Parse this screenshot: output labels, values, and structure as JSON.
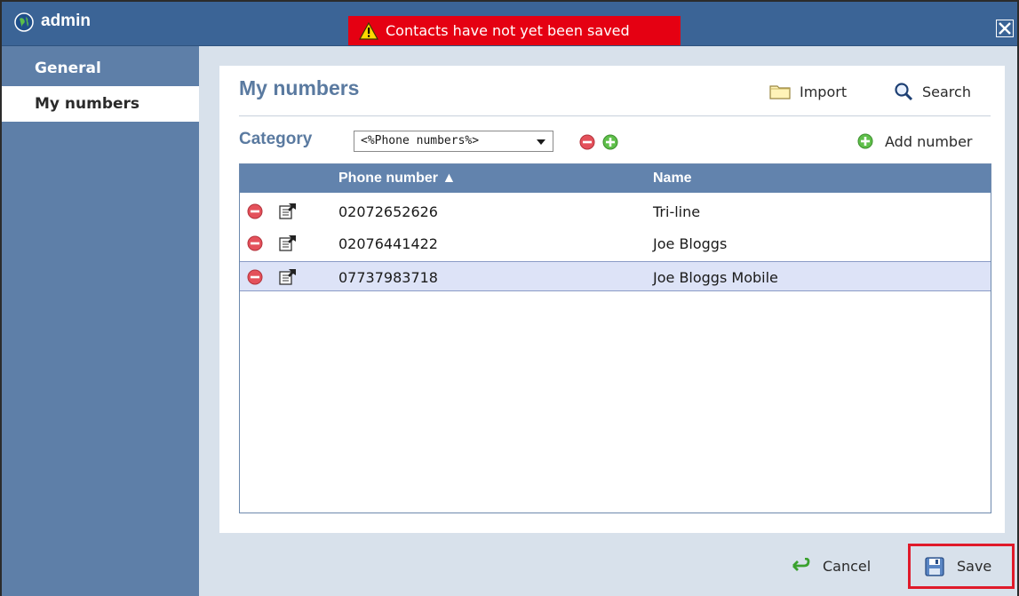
{
  "window": {
    "title": "admin",
    "warning": "Contacts have not yet been saved",
    "icons": {
      "app": "globe-icon",
      "warning": "warning-icon",
      "close": "close-icon"
    }
  },
  "sidebar": {
    "items": [
      {
        "label": "General",
        "active": false
      },
      {
        "label": "My numbers",
        "active": true
      }
    ]
  },
  "main": {
    "heading": "My numbers",
    "toolbar": {
      "import_label": "Import",
      "search_label": "Search"
    },
    "category": {
      "label": "Category",
      "selected": "<%Phone numbers%>",
      "add_number_label": "Add number"
    },
    "table": {
      "columns": [
        "Phone number ▲",
        "Name"
      ],
      "rows": [
        {
          "phone": "02072652626",
          "name": "Tri-line",
          "selected": false
        },
        {
          "phone": "02076441422",
          "name": "Joe Bloggs",
          "selected": false
        },
        {
          "phone": "07737983718",
          "name": "Joe Bloggs Mobile",
          "selected": true
        }
      ]
    }
  },
  "footer": {
    "cancel_label": "Cancel",
    "save_label": "Save"
  },
  "colors": {
    "titlebar": "#3b6496",
    "sidebar": "#5e7fa8",
    "warning_bg": "#e50012",
    "heading": "#5a7aa0",
    "table_header": "#6283ad",
    "selected_row": "#dde3f7",
    "save_highlight": "#e01a2a"
  }
}
